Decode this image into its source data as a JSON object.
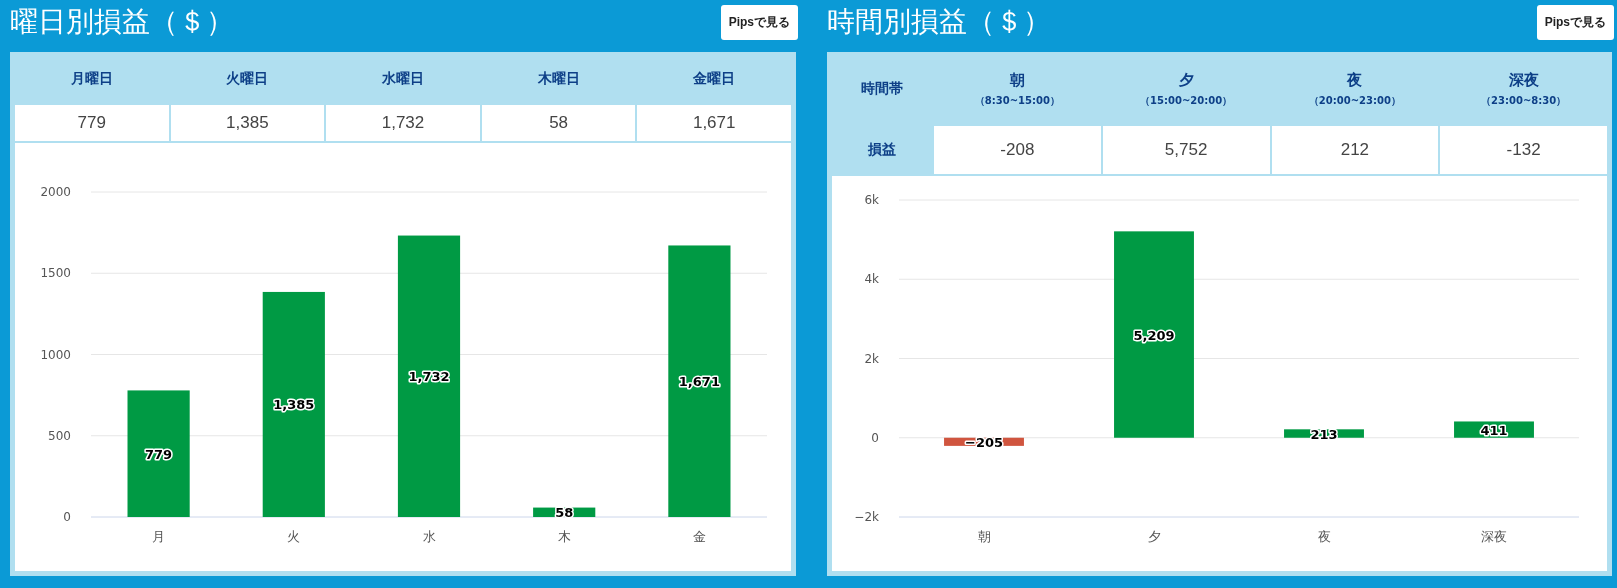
{
  "panels": [
    {
      "title": "曜日別損益（＄）",
      "button": "Pipsで見る",
      "table": {
        "columns": [
          "月曜日",
          "火曜日",
          "水曜日",
          "木曜日",
          "金曜日"
        ],
        "rows": [
          {
            "cells": [
              "779",
              "1,385",
              "1,732",
              "58",
              "1,671"
            ]
          }
        ]
      },
      "chart_data": {
        "type": "bar",
        "categories": [
          "月",
          "火",
          "水",
          "木",
          "金"
        ],
        "series": [
          {
            "color": "#009a44",
            "values": [
              779,
              1385,
              1732,
              58,
              1671
            ]
          }
        ],
        "ylim": [
          0,
          2000
        ],
        "yticks": [
          0,
          500,
          1000,
          1500,
          2000
        ],
        "grid": true,
        "value_labels": [
          "779",
          "1,385",
          "1,732",
          "58",
          "1,671"
        ]
      }
    },
    {
      "title": "時間別損益（＄）",
      "button": "Pipsで見る",
      "table": {
        "corner": "時間帯",
        "columns": [
          {
            "label": "朝",
            "sub": "（8:30~15:00）"
          },
          {
            "label": "夕",
            "sub": "（15:00~20:00）"
          },
          {
            "label": "夜",
            "sub": "（20:00~23:00）"
          },
          {
            "label": "深夜",
            "sub": "（23:00~8:30）"
          }
        ],
        "rows": [
          {
            "label": "損益",
            "cells": [
              "-208",
              "5,752",
              "212",
              "-132"
            ]
          }
        ]
      },
      "chart_data": {
        "type": "bar",
        "categories": [
          "朝",
          "夕",
          "夜",
          "深夜"
        ],
        "series": [
          {
            "color": "#009a44",
            "values": [
              null,
              5209,
              213,
              411
            ]
          },
          {
            "color": "#d0553f",
            "values": [
              -205,
              null,
              null,
              null
            ]
          }
        ],
        "stacked": true,
        "ylim": [
          -2000,
          6000
        ],
        "yticks": [
          {
            "value": -2000,
            "label": "−2k"
          },
          {
            "value": 0,
            "label": "0"
          },
          {
            "value": 2000,
            "label": "2k"
          },
          {
            "value": 4000,
            "label": "4k"
          },
          {
            "value": 6000,
            "label": "6k"
          }
        ],
        "grid": true,
        "value_labels": [
          "−205",
          "5,209",
          "213",
          "411"
        ]
      }
    }
  ]
}
